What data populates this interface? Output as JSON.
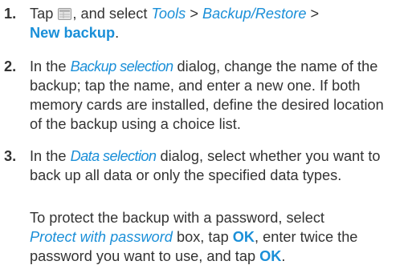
{
  "step1": {
    "number": "1.",
    "tap": "Tap",
    "icon": "menu-grid-icon",
    "and_select": ", and select",
    "tools": "Tools",
    "sep1": ">",
    "backup_restore": "Backup/Restore",
    "sep2": ">",
    "new_backup": "New backup",
    "period": "."
  },
  "step2": {
    "number": "2.",
    "in_the": "In the",
    "dialog_name": "Backup selection",
    "line1_rest": "dialog, change the name of the",
    "line2": "backup; tap the name, and enter a new one. If both",
    "line3": "memory cards are installed, define the desired location",
    "line4": "of the backup using a choice list."
  },
  "step3": {
    "number": "3.",
    "in_the": "In the",
    "dialog_name": "Data selection",
    "line1_rest": "dialog, select whether you want to",
    "line2": "back up all data or only the specified data types."
  },
  "note": {
    "line1": "To protect the backup with a password, select",
    "protect_box": "Protect with password",
    "box_tap": "box, tap",
    "ok1": "OK",
    "enter_twice": ", enter twice the",
    "line3_start": "password you want to use, and tap",
    "ok2": "OK",
    "period": "."
  },
  "colors": {
    "text": "#333333",
    "link": "#1a8fd8"
  }
}
